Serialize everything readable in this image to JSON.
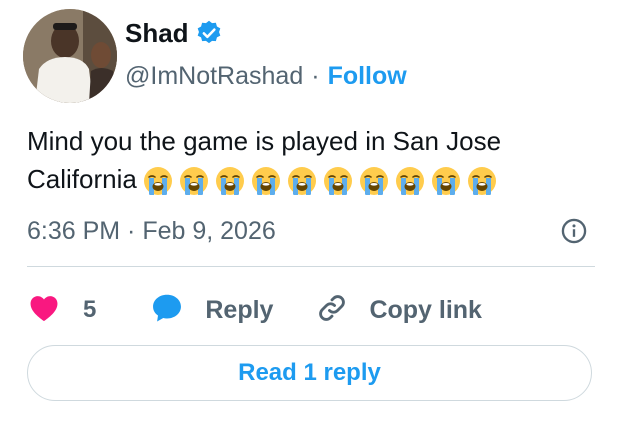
{
  "author": {
    "name": "Shad",
    "handle": "@ImNotRashad",
    "separator": "·",
    "follow_label": "Follow",
    "verified": true
  },
  "tweet": {
    "text": "Mind you the game is played in San Jose California",
    "emoji": "loudly-crying-face",
    "emoji_count": 10,
    "timestamp": "6:36 PM · Feb 9, 2026"
  },
  "actions": {
    "like_count": "5",
    "reply_label": "Reply",
    "copy_link_label": "Copy link"
  },
  "footer": {
    "read_replies_label": "Read 1 reply"
  },
  "colors": {
    "accent": "#1d9bf0",
    "like": "#f91880",
    "secondary_text": "#536471",
    "border": "#cfd9de"
  }
}
